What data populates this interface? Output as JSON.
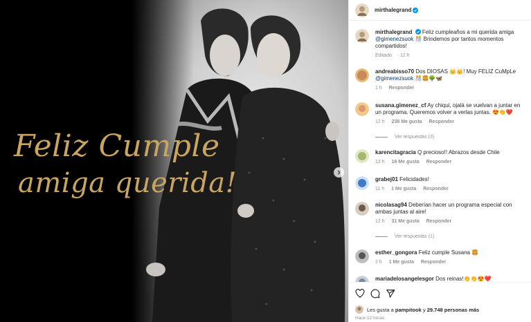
{
  "post": {
    "username": "mirthalegrand",
    "caption_text": "Feliz cumpleaños a mi querida amiga",
    "caption_mention": "@gimenezsuok",
    "caption_rest": "🎊 Brindemos por tantos momentos compartidos!",
    "edited": "Editado",
    "time": "12 h",
    "image_line1": "Feliz Cumple",
    "image_line2": "amiga querida!"
  },
  "comments": [
    {
      "user": "andreabisso70",
      "text": "Dos DIOSAS 👑👑! Muy FELIZ CuMpLe",
      "mention": "@gimenezsuok",
      "rest": "🎊🍔🌳🦋",
      "time": "1 h",
      "reply": "Responder",
      "avatar_color": "#c98a5a"
    },
    {
      "user": "susana.gimenez_cf",
      "text": "Ay chiqui, ojalá se vuelvan a juntar en un programa. Queremos volver a verlas juntas. 😍👏❤️",
      "time": "12 h",
      "likes": "238 Me gusta",
      "reply": "Responder",
      "avatar_color": "#d99a6c"
    },
    {
      "user": "karencitagracia",
      "text": "Q precioso!! Abrazos desde Chile",
      "time": "12 h",
      "likes": "16 Me gusta",
      "reply": "Responder",
      "avatar_color": "#a6b86e"
    },
    {
      "user": "grabej01",
      "text": "Felicidades!",
      "time": "11 h",
      "likes": "1 Me gusta",
      "reply": "Responder",
      "avatar_color": "#3f7ac9"
    },
    {
      "user": "nicolasag94",
      "text": "Deberían hacer un programa especial con ambas juntas al aire!",
      "time": "12 h",
      "likes": "31 Me gusta",
      "reply": "Responder",
      "avatar_color": "#6e5a4a"
    },
    {
      "user": "esther_gongora",
      "text": "Feliz cumple Susana 🍔",
      "time": "2 h",
      "likes": "1 Me gusta",
      "reply": "Responder",
      "avatar_color": "#555555"
    },
    {
      "user": "mariadelosangelesgor",
      "text": "Dos reinas!👏👏😍❤️",
      "avatar_color": "#7a8aa0"
    }
  ],
  "view_replies": [
    "Ver respuestas (3)",
    "Ver respuestas (1)"
  ],
  "likes": {
    "prefix": "Les gusta a",
    "user": "pampitook",
    "middle": "y",
    "count": "29.748 personas más"
  },
  "posted_ago": "Hace 12 horas",
  "colors": {
    "link": "#00376b",
    "muted": "#8e8e8e",
    "verified": "#0095f6",
    "gold_text": "#c9a660"
  }
}
